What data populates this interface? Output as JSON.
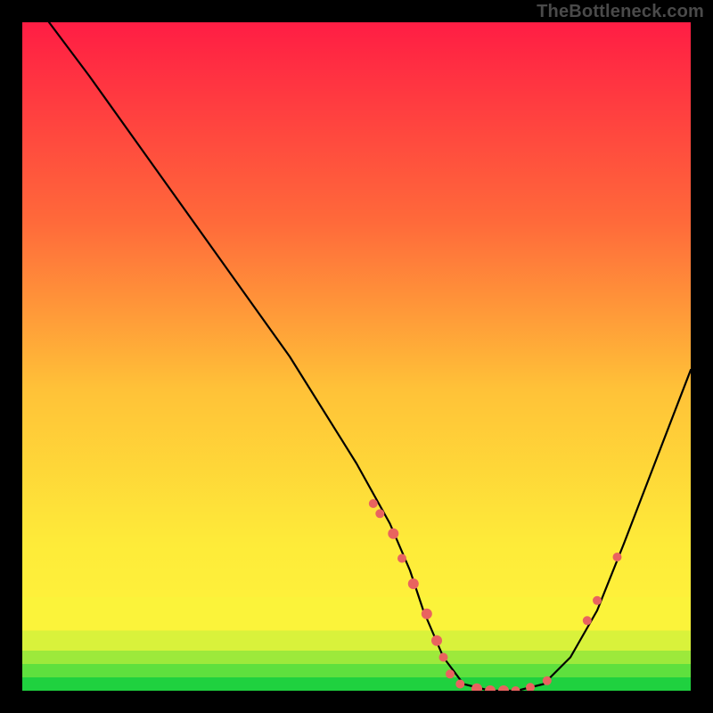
{
  "watermark": "TheBottleneck.com",
  "chart_data": {
    "type": "line",
    "title": "",
    "xlabel": "",
    "ylabel": "",
    "xlim": [
      0,
      100
    ],
    "ylim": [
      0,
      100
    ],
    "grid": false,
    "legend": false,
    "series": [
      {
        "name": "curve",
        "x": [
          4,
          10,
          20,
          30,
          40,
          50,
          55,
          58,
          60,
          63,
          66,
          70,
          74,
          78,
          82,
          86,
          90,
          95,
          100
        ],
        "y": [
          100,
          92,
          78,
          64,
          50,
          34,
          25,
          18,
          12,
          5,
          1,
          0,
          0,
          1,
          5,
          12,
          22,
          35,
          48
        ]
      }
    ],
    "markers": [
      {
        "x": 52.5,
        "y": 28.0,
        "r": 5
      },
      {
        "x": 53.5,
        "y": 26.5,
        "r": 5
      },
      {
        "x": 55.5,
        "y": 23.5,
        "r": 6
      },
      {
        "x": 56.8,
        "y": 19.8,
        "r": 5
      },
      {
        "x": 58.5,
        "y": 16.0,
        "r": 6
      },
      {
        "x": 60.5,
        "y": 11.5,
        "r": 6
      },
      {
        "x": 62.0,
        "y": 7.5,
        "r": 6
      },
      {
        "x": 63.0,
        "y": 5.0,
        "r": 5
      },
      {
        "x": 64.0,
        "y": 2.5,
        "r": 5
      },
      {
        "x": 65.5,
        "y": 1.0,
        "r": 5
      },
      {
        "x": 68.0,
        "y": 0.3,
        "r": 6
      },
      {
        "x": 70.0,
        "y": 0.0,
        "r": 6
      },
      {
        "x": 72.0,
        "y": 0.0,
        "r": 6
      },
      {
        "x": 73.8,
        "y": 0.0,
        "r": 5
      },
      {
        "x": 76.0,
        "y": 0.5,
        "r": 5
      },
      {
        "x": 78.5,
        "y": 1.5,
        "r": 5
      },
      {
        "x": 84.5,
        "y": 10.5,
        "r": 5
      },
      {
        "x": 86.0,
        "y": 13.5,
        "r": 5
      },
      {
        "x": 89.0,
        "y": 20.0,
        "r": 5
      }
    ],
    "bands": [
      {
        "y0": 0,
        "y1": 2,
        "color": "#1fd13f"
      },
      {
        "y0": 2,
        "y1": 4,
        "color": "#5ee03e"
      },
      {
        "y0": 4,
        "y1": 6,
        "color": "#9de93b"
      },
      {
        "y0": 6,
        "y1": 9,
        "color": "#d9f23b"
      },
      {
        "y0": 9,
        "y1": 14,
        "color": "#fbf33a"
      }
    ],
    "gradient_stops": [
      {
        "offset": 0,
        "color": "#ff1d44"
      },
      {
        "offset": 30,
        "color": "#ff6a3a"
      },
      {
        "offset": 55,
        "color": "#ffc238"
      },
      {
        "offset": 78,
        "color": "#feeb39"
      },
      {
        "offset": 100,
        "color": "#fef93c"
      }
    ],
    "marker_color": "#e9635f",
    "curve_color": "#000000"
  }
}
